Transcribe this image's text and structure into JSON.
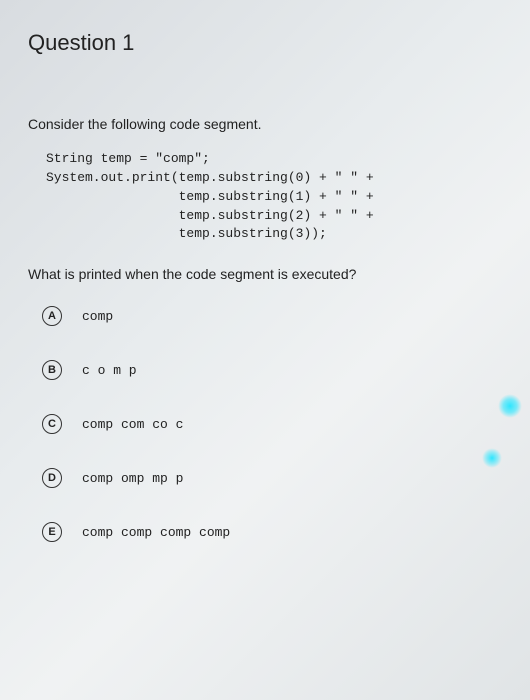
{
  "title": "Question 1",
  "prompt": "Consider the following code segment.",
  "code": "String temp = \"comp\";\nSystem.out.print(temp.substring(0) + \" \" +\n                 temp.substring(1) + \" \" +\n                 temp.substring(2) + \" \" +\n                 temp.substring(3));",
  "subprompt": "What is printed when the code segment is executed?",
  "options": [
    {
      "letter": "A",
      "text": "comp"
    },
    {
      "letter": "B",
      "text": "c o m p"
    },
    {
      "letter": "C",
      "text": "comp com co c"
    },
    {
      "letter": "D",
      "text": "comp omp mp p"
    },
    {
      "letter": "E",
      "text": "comp comp comp comp"
    }
  ]
}
